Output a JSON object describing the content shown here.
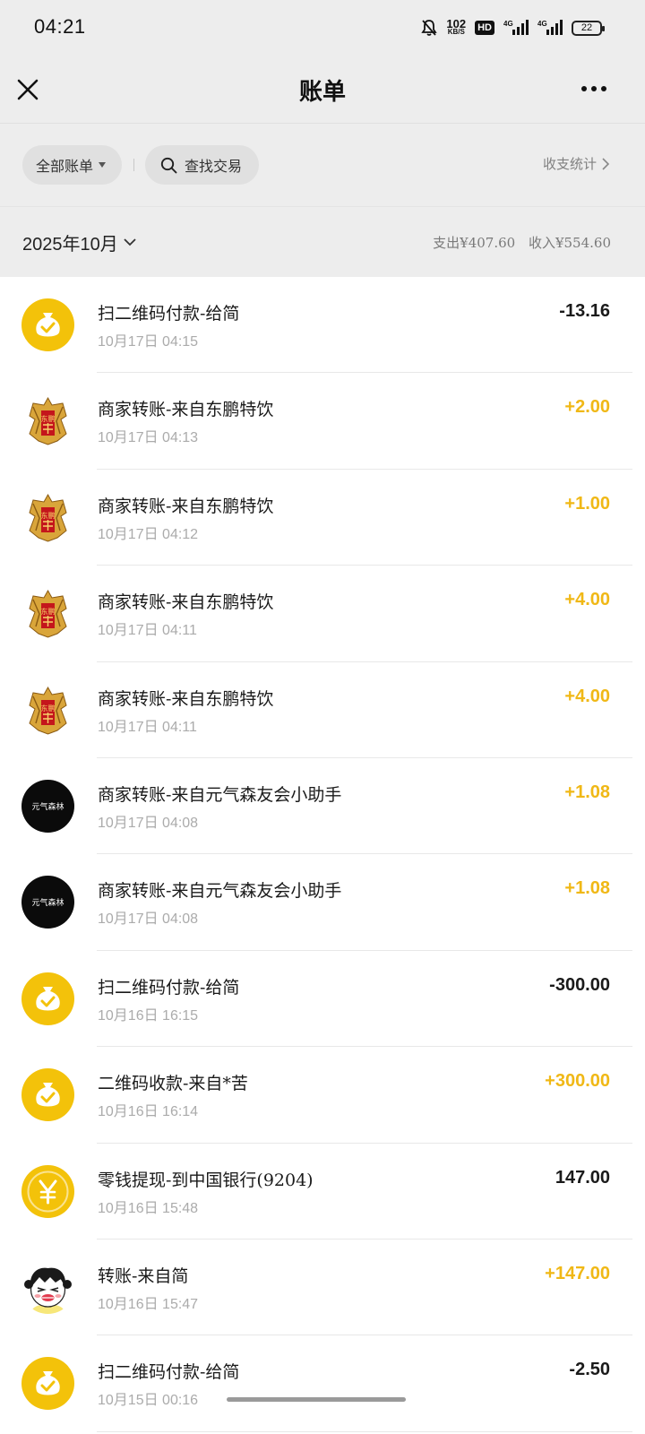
{
  "status_bar": {
    "time": "04:21",
    "speed_value": "102",
    "speed_unit": "KB/S",
    "hd_label": "HD",
    "network_1": "4G",
    "network_2": "4G",
    "battery": "22"
  },
  "header": {
    "title": "账单"
  },
  "filters": {
    "all_bills_label": "全部账单",
    "search_label": "查找交易",
    "stats_label": "收支统计"
  },
  "month": {
    "label": "2025年10月",
    "expense": "支出¥407.60",
    "income": "收入¥554.60"
  },
  "transactions": [
    {
      "icon": "money-bag-icon",
      "title": "扫二维码付款-给简",
      "time": "10月17日 04:15",
      "amount": "-13.16",
      "type": "out"
    },
    {
      "icon": "dongpeng-logo-icon",
      "title": "商家转账-来自东鹏特饮",
      "time": "10月17日 04:13",
      "amount": "+2.00",
      "type": "in"
    },
    {
      "icon": "dongpeng-logo-icon",
      "title": "商家转账-来自东鹏特饮",
      "time": "10月17日 04:12",
      "amount": "+1.00",
      "type": "in"
    },
    {
      "icon": "dongpeng-logo-icon",
      "title": "商家转账-来自东鹏特饮",
      "time": "10月17日 04:11",
      "amount": "+4.00",
      "type": "in"
    },
    {
      "icon": "dongpeng-logo-icon",
      "title": "商家转账-来自东鹏特饮",
      "time": "10月17日 04:11",
      "amount": "+4.00",
      "type": "in"
    },
    {
      "icon": "genki-forest-logo-icon",
      "title": "商家转账-来自元气森友会小助手",
      "time": "10月17日 04:08",
      "amount": "+1.08",
      "type": "in"
    },
    {
      "icon": "genki-forest-logo-icon",
      "title": "商家转账-来自元气森友会小助手",
      "time": "10月17日 04:08",
      "amount": "+1.08",
      "type": "in"
    },
    {
      "icon": "money-bag-icon",
      "title": "扫二维码付款-给简",
      "time": "10月16日 16:15",
      "amount": "-300.00",
      "type": "out"
    },
    {
      "icon": "money-bag-icon",
      "title": "二维码收款-来自*苦",
      "time": "10月16日 16:14",
      "amount": "+300.00",
      "type": "in"
    },
    {
      "icon": "yuan-coin-icon",
      "title": "零钱提现-到中国银行(9204)",
      "time": "10月16日 15:48",
      "amount": "147.00",
      "type": "out"
    },
    {
      "icon": "cartoon-avatar-icon",
      "title": "转账-来自简",
      "time": "10月16日 15:47",
      "amount": "+147.00",
      "type": "in"
    },
    {
      "icon": "money-bag-icon",
      "title": "扫二维码付款-给简",
      "time": "10月15日 00:16",
      "amount": "-2.50",
      "type": "out"
    }
  ],
  "logo_text": {
    "genki_forest": "元气森林",
    "dongpeng": "东鹏"
  },
  "colors": {
    "income": "#f0b816",
    "pouch": "#f3c20a",
    "background_header": "#ededed"
  }
}
